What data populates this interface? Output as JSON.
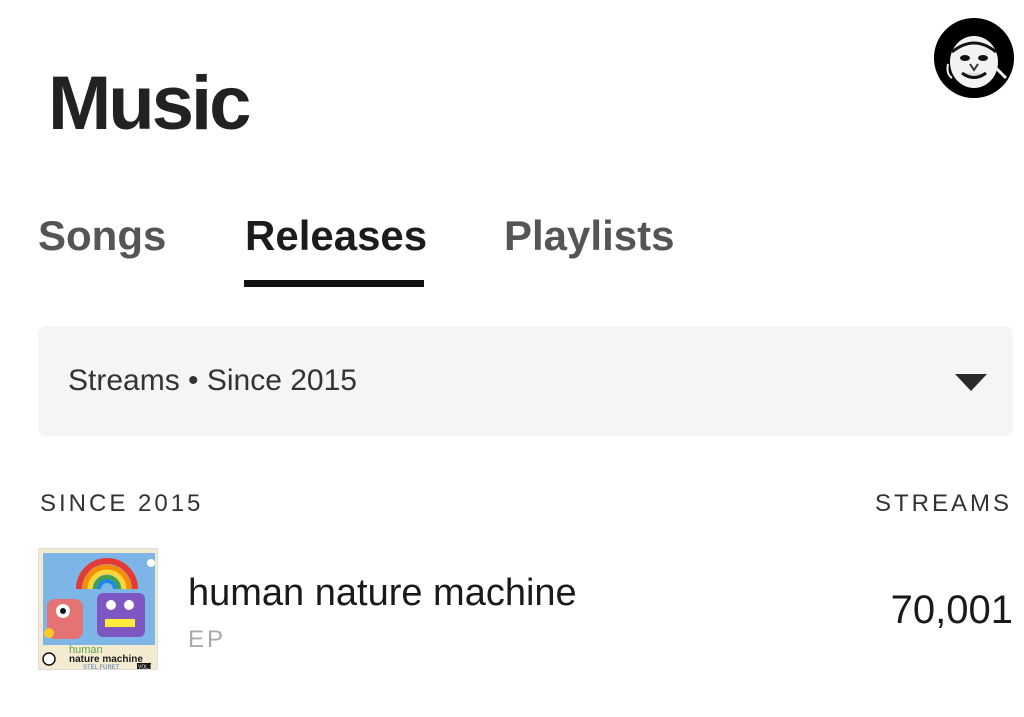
{
  "page": {
    "title": "Music"
  },
  "tabs": [
    {
      "label": "Songs",
      "active": false
    },
    {
      "label": "Releases",
      "active": true
    },
    {
      "label": "Playlists",
      "active": false
    }
  ],
  "filter": {
    "label": "Streams • Since 2015",
    "icon": "chevron-down-icon"
  },
  "list": {
    "period_header": "SINCE 2015",
    "metric_header": "STREAMS",
    "items": [
      {
        "title": "human nature machine",
        "type": "EP",
        "streams": "70,001",
        "cover": {
          "line1": "human",
          "line2": "nature machine",
          "artist": "STEL FURET",
          "volume": "VOL.1"
        }
      }
    ]
  },
  "colors": {
    "text": "#1a1a1a",
    "tab_inactive": "#555555",
    "indicator": "#111111",
    "filter_bg": "#f5f5f5",
    "subtle": "#aaaaaa"
  }
}
